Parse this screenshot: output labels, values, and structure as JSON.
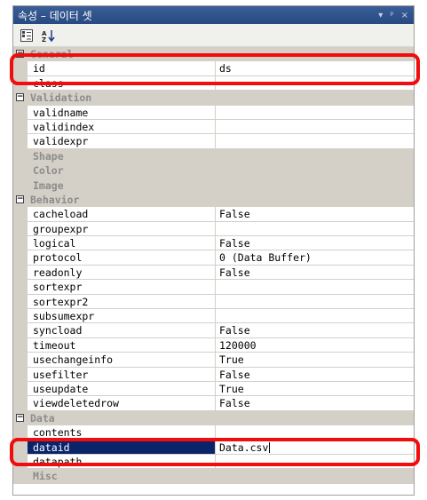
{
  "window": {
    "title": "속성 – 데이터 셋",
    "controls": [
      "▾",
      "ᵖ",
      "×"
    ]
  },
  "toolbar": {
    "categorized_icon": "categorized-icon",
    "alphabetical_icon": "sort-alphabetical-icon"
  },
  "categories": {
    "general": "General",
    "validation": "Validation",
    "behavior": "Behavior",
    "data": "Data"
  },
  "general": [
    {
      "name": "id",
      "value": "ds"
    },
    {
      "name": "class",
      "value": ""
    }
  ],
  "validation": [
    {
      "name": "validname",
      "value": ""
    },
    {
      "name": "validindex",
      "value": ""
    },
    {
      "name": "validexpr",
      "value": ""
    }
  ],
  "greyed": {
    "shape": "Shape",
    "color": "Color",
    "image": "Image",
    "misc": "Misc"
  },
  "behavior": [
    {
      "name": "cacheload",
      "value": "False"
    },
    {
      "name": "groupexpr",
      "value": ""
    },
    {
      "name": "logical",
      "value": "False"
    },
    {
      "name": "protocol",
      "value": "0 (Data Buffer)"
    },
    {
      "name": "readonly",
      "value": "False"
    },
    {
      "name": "sortexpr",
      "value": ""
    },
    {
      "name": "sortexpr2",
      "value": ""
    },
    {
      "name": "subsumexpr",
      "value": ""
    },
    {
      "name": "syncload",
      "value": "False"
    },
    {
      "name": "timeout",
      "value": "120000"
    },
    {
      "name": "usechangeinfo",
      "value": "True"
    },
    {
      "name": "usefilter",
      "value": "False"
    },
    {
      "name": "useupdate",
      "value": "True"
    },
    {
      "name": "viewdeletedrow",
      "value": "False"
    }
  ],
  "data": [
    {
      "name": "contents",
      "value": ""
    },
    {
      "name": "dataid",
      "value": "Data.csv"
    },
    {
      "name": "datapath",
      "value": ""
    }
  ],
  "colors": {
    "title_bar": "#274a82",
    "selection": "#0a246a",
    "category_bg": "#d4d0c8",
    "annotation": "#f10d0d"
  }
}
